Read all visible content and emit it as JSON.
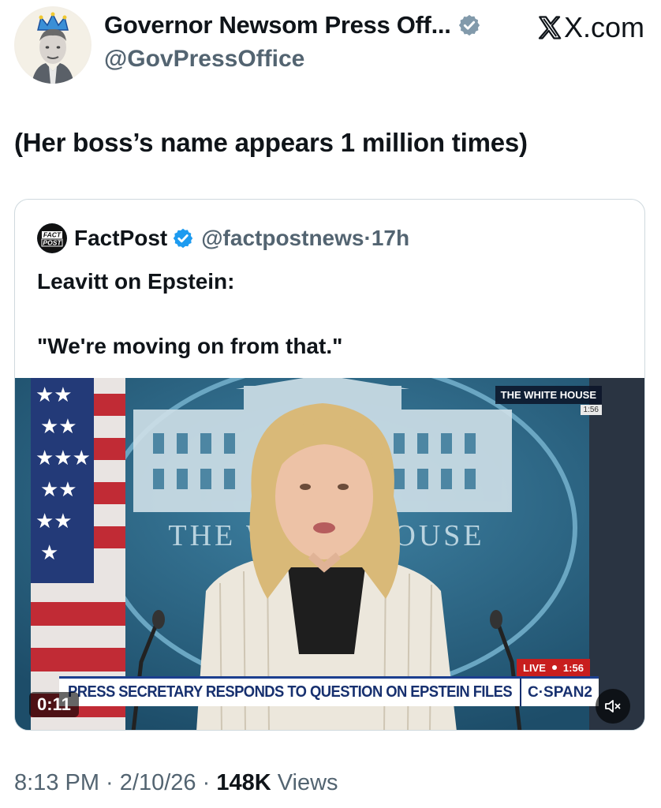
{
  "author": {
    "display_name": "Governor Newsom Press Off...",
    "handle": "@GovPressOffice",
    "verified": true
  },
  "source_label": "X.com",
  "tweet_text": "(Her boss’s name appears 1 million times)",
  "quoted": {
    "display_name": "FactPost",
    "handle": "@factpostnews",
    "separator": "·",
    "time_ago": "17h",
    "logo_text": [
      "FACT",
      "POST"
    ],
    "line1": "Leavitt on Epstein:",
    "line2": "\"We're moving on from that.\"",
    "video": {
      "network_tag": "THE WHITE HOUSE",
      "network_time": "1:56",
      "live_label": "LIVE",
      "live_time": "1:56",
      "chyron": "PRESS SECRETARY RESPONDS TO QUESTION ON EPSTEIN FILES",
      "channel": "C·SPAN2",
      "podium_text": "THE WHITE HOUSE",
      "timer": "0:11"
    }
  },
  "footer": {
    "time": "8:13 PM",
    "sep1": " · ",
    "date": "2/10/26",
    "sep2": " · ",
    "views_count": "148K",
    "views_label": " Views"
  },
  "colors": {
    "verified_blue": "#1d9bf0",
    "text_primary": "#0f1419",
    "text_secondary": "#536471",
    "chyron_blue": "#17306f",
    "live_red": "#c81e1e"
  }
}
